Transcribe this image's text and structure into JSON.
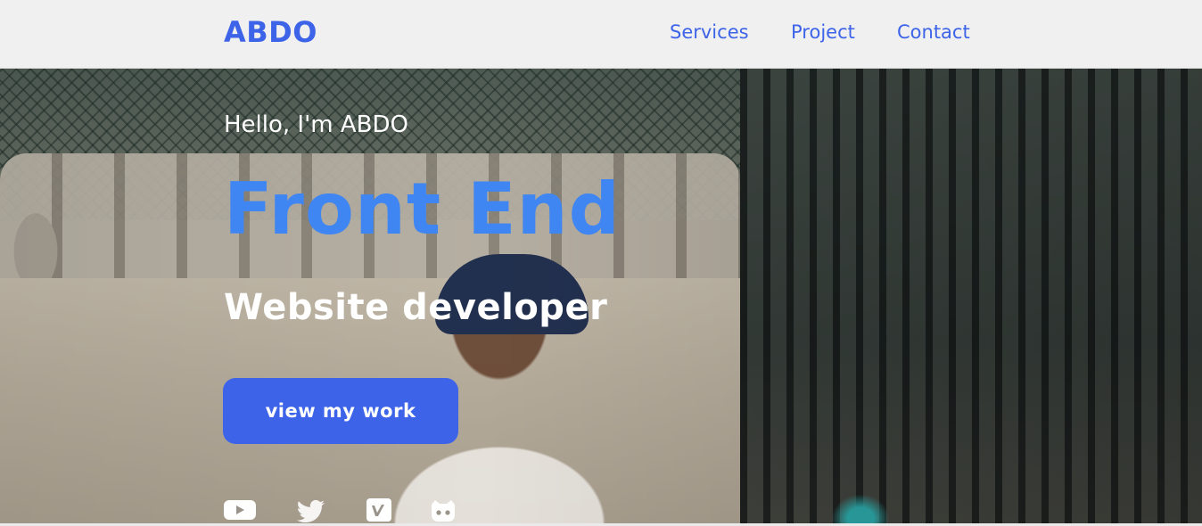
{
  "header": {
    "logo": "ABDO",
    "nav": [
      "Services",
      "Project",
      "Contact"
    ]
  },
  "hero": {
    "greeting": "Hello, I'm ABDO",
    "title": "Front End",
    "subtitle": "Website developer",
    "cta_label": "view my work",
    "social_icons": [
      "youtube-icon",
      "twitter-icon",
      "vimeo-icon",
      "github-icon"
    ]
  },
  "colors": {
    "brand": "#3d63e8",
    "title_blue": "#3f86f2",
    "nav_bg": "#f0f0f0",
    "text_light": "#ffffff"
  }
}
